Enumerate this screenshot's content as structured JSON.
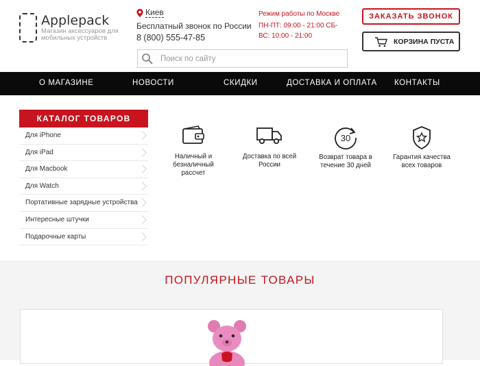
{
  "header": {
    "logo_title": "Applepack",
    "logo_subtitle": "Магазин аксессуаров для мобильных устройств",
    "city": "Киев",
    "free_call_label": "Бесплатный звонок по России",
    "phone": "8 (800) 555-47-85",
    "hours_title": "Режим работы по Москве",
    "hours_detail": "ПН-ПТ: 09:00 - 21:00 СБ-ВС: 10:00 - 21:00",
    "order_call_label": "ЗАКАЗАТЬ ЗВОНОК",
    "cart_label": "КОРЗИНА ПУСТА",
    "search_placeholder": "Поиск по сайту"
  },
  "nav": {
    "items": [
      {
        "label": "О МАГАЗИНЕ"
      },
      {
        "label": "НОВОСТИ"
      },
      {
        "label": "СКИДКИ"
      },
      {
        "label": "ДОСТАВКА И ОПЛАТА"
      },
      {
        "label": "КОНТАКТЫ"
      }
    ]
  },
  "catalog": {
    "title": "КАТАЛОГ ТОВАРОВ",
    "items": [
      {
        "label": "Для iPhone"
      },
      {
        "label": "Для iPad"
      },
      {
        "label": "Для Macbook"
      },
      {
        "label": "Для Watch"
      },
      {
        "label": "Портативные зарядные устройства"
      },
      {
        "label": "Интересные штучки"
      },
      {
        "label": "Подарочные карты"
      }
    ]
  },
  "features": [
    {
      "icon": "wallet-icon",
      "label": "Наличный и безналичный рассчет"
    },
    {
      "icon": "truck-icon",
      "label": "Доставка по всей России"
    },
    {
      "icon": "return-30-icon",
      "label": "Возврат товара в течение 30 дней",
      "badge": "30"
    },
    {
      "icon": "shield-star-icon",
      "label": "Гарантия качества всех товаров"
    }
  ],
  "popular": {
    "title": "ПОПУЛЯРНЫЕ ТОВАРЫ"
  },
  "colors": {
    "accent": "#c8141e",
    "nav_bg": "#0a0a0a",
    "section_bg": "#f4f4f4"
  }
}
